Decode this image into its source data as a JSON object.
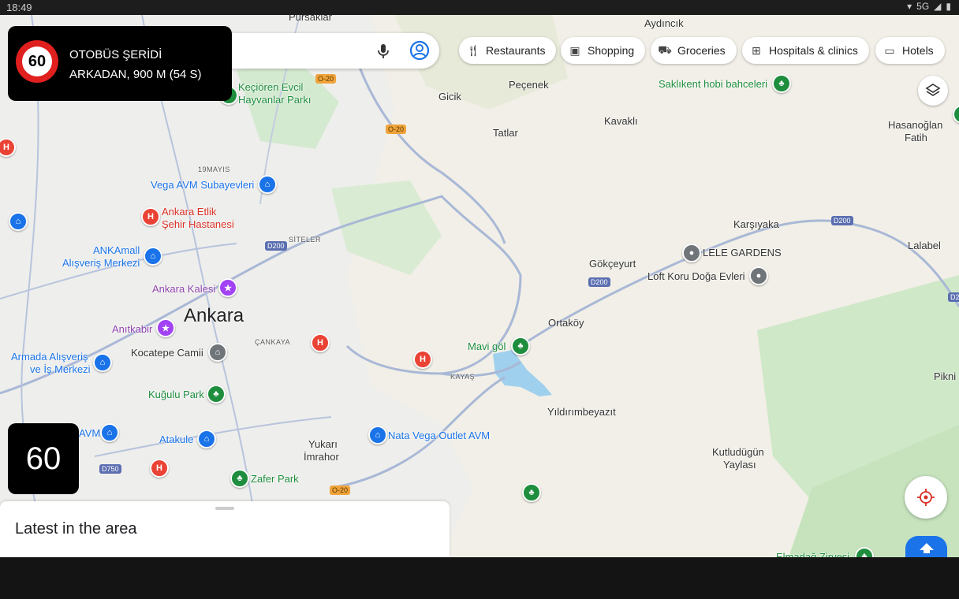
{
  "status_bar": {
    "time": "18:49",
    "network": "5G"
  },
  "alert": {
    "speed_sign": "60",
    "line1": "OTOBÜS ŞERİDİ",
    "line2": "ARKADAN, 900 M (54 S)"
  },
  "speed": "60",
  "search": {
    "mic_icon": "mic-icon",
    "account_icon": "account-icon"
  },
  "chips": [
    {
      "label": "Restaurants",
      "icon": "fork-knife-icon"
    },
    {
      "label": "Shopping",
      "icon": "shopping-bag-icon"
    },
    {
      "label": "Groceries",
      "icon": "cart-icon"
    },
    {
      "label": "Hospitals & clinics",
      "icon": "hospital-icon"
    },
    {
      "label": "Hotels",
      "icon": "bed-icon"
    }
  ],
  "sheet": {
    "title": "Latest in the area"
  },
  "map_labels": {
    "pursaklar": "Pursaklar",
    "aydincik": "Aydıncık",
    "pecenek": "Peçenek",
    "gicik": "Gicik",
    "kavakli": "Kavaklı",
    "tatlar": "Tatlar",
    "hasanoglan": "Hasanoğlan",
    "fatih": "Fatih",
    "saklikent": "Saklıkent hobi bahceleri",
    "kecioren": "Keçiören Evcil",
    "kecioren2": "Hayvanlar Parkı",
    "mayis": "19MAYIS",
    "vega": "Vega AVM Subayevleri",
    "etlik1": "Ankara Etlik",
    "etlik2": "Şehir Hastanesi",
    "siteler": "SİTELER",
    "ankamall1": "ANKAmall",
    "ankamall2": "Alışveriş Merkezi",
    "kalesi": "Ankara Kalesi",
    "ankara": "Ankara",
    "anitkabir": "Anıtkabir",
    "cankaya": "ÇANKAYA",
    "kocatepe": "Kocatepe Camii",
    "armada1": "Armada Alışveriş",
    "armada2": "ve İş Merkezi",
    "kugulu": "Kuğulu Park",
    "avm": "AVM",
    "atakule": "Atakule",
    "yukari": "Yukarı",
    "imrahor": "İmrahor",
    "natavega": "Nata Vega Outlet AVM",
    "zafer": "Zafer Park",
    "mavigol": "Mavi göl",
    "kayas": "KAYAŞ",
    "ortakoy": "Ortaköy",
    "gokceyurt": "Gökçeyurt",
    "karsiyaka": "Karşıyaka",
    "lele": "LELE GARDENS",
    "loft": "Loft Koru Doğa Evleri",
    "lalabel": "Lalabel",
    "yildirim": "Yıldırımbeyazıt",
    "kutlu1": "Kutludügün",
    "kutlu2": "Yaylası",
    "pikni": "Pikni",
    "elmadag": "Elmadağ Zirvesi"
  },
  "road_shields": {
    "d200": "D200",
    "o20": "O-20",
    "d750": "D750",
    "d2": "D2"
  }
}
